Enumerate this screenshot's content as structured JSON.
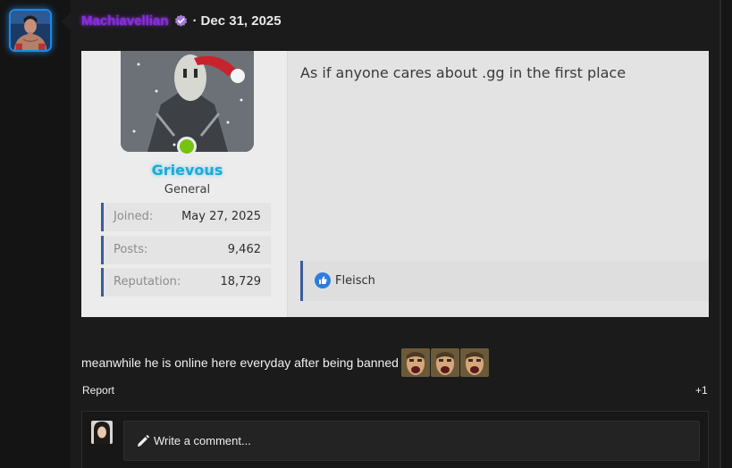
{
  "post": {
    "author": "Machiavellian",
    "separator": "·",
    "date": "Dec 31, 2025",
    "verified_icon": "verified-badge-icon",
    "text": "meanwhile he is online here everyday after being banned",
    "emotes": [
      "screaming-face-emote",
      "screaming-face-emote",
      "screaming-face-emote"
    ],
    "report_label": "Report",
    "reaction_count": "+1"
  },
  "embed": {
    "member": {
      "name": "Grievous",
      "rank": "General",
      "status": "online",
      "stats": [
        {
          "label": "Joined:",
          "value": "May 27, 2025"
        },
        {
          "label": "Posts:",
          "value": "9,462"
        },
        {
          "label": "Reputation:",
          "value": "18,729"
        }
      ]
    },
    "message": "As if anyone cares about .gg in the first place",
    "reaction": {
      "icon": "thumbs-up-icon",
      "user": "Fleisch"
    }
  },
  "comment": {
    "placeholder": "Write a comment...",
    "icon": "pencil-icon"
  },
  "colors": {
    "accent": "#1e88e5",
    "username": "#8a2be2",
    "embed_name": "#1ea9d6",
    "online": "#74c410",
    "stat_border": "#3d5a99"
  }
}
